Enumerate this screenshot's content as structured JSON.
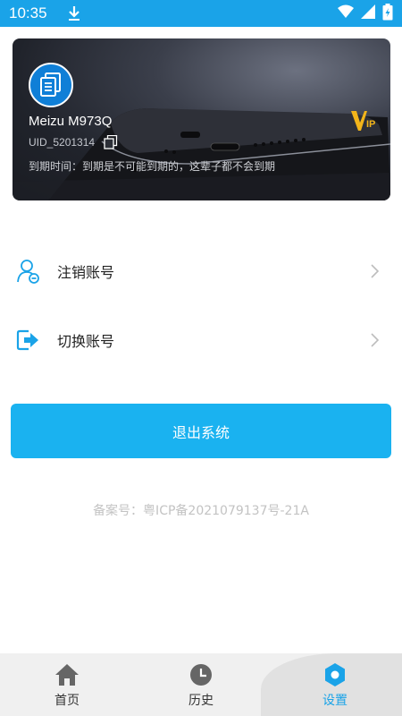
{
  "status_bar": {
    "time": "10:35",
    "icons": [
      "download-icon",
      "wifi-icon",
      "signal-icon",
      "battery-charging-icon"
    ]
  },
  "profile": {
    "device_name": "Meizu M973Q",
    "uid": "UID_5201314",
    "expire_text": "到期时间：到期是不可能到期的，这辈子都不会到期",
    "vip_label": "VIP"
  },
  "menu": {
    "items": [
      {
        "label": "注销账号",
        "icon": "user-remove-icon"
      },
      {
        "label": "切换账号",
        "icon": "switch-account-icon"
      }
    ]
  },
  "logout_button": "退出系统",
  "icp_text": "备案号：粤ICP备2021079137号-21A",
  "bottom_nav": {
    "items": [
      {
        "label": "首页",
        "icon": "home-icon"
      },
      {
        "label": "历史",
        "icon": "clock-icon"
      },
      {
        "label": "设置",
        "icon": "settings-icon"
      }
    ],
    "active_index": 2
  },
  "colors": {
    "accent": "#1aa3e8",
    "button": "#1ab2f0"
  }
}
